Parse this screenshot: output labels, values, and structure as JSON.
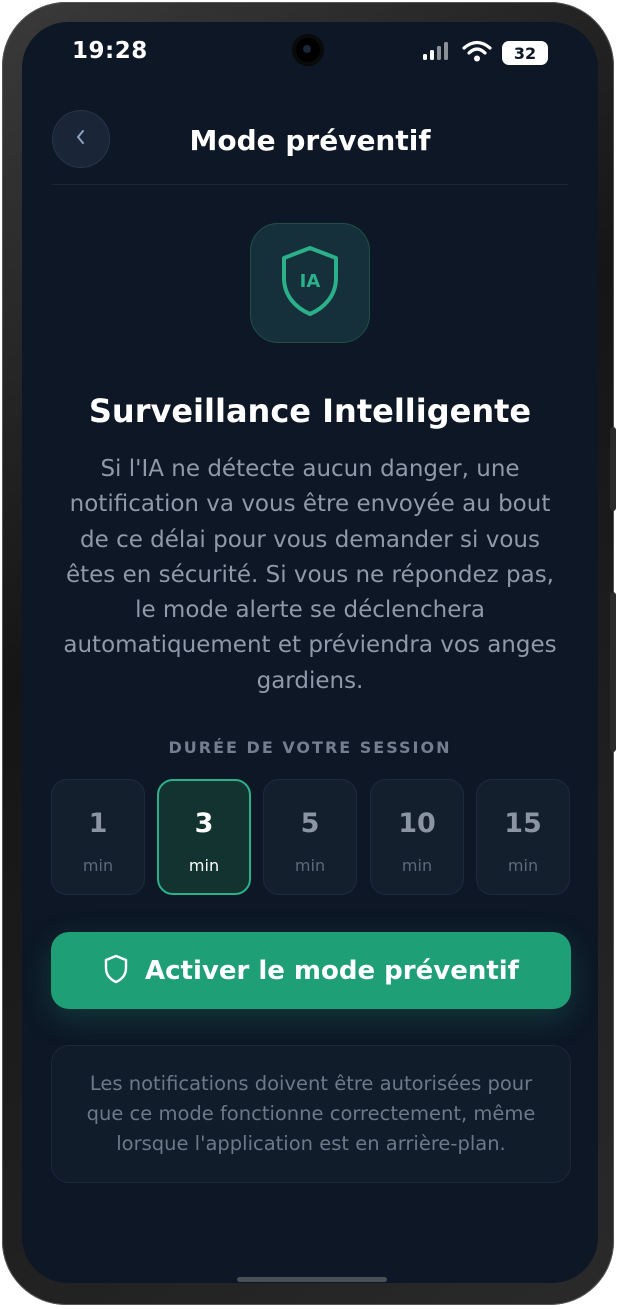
{
  "status_bar": {
    "time": "19:28",
    "battery": "32"
  },
  "header": {
    "back_symbol": "‹",
    "title": "Mode préventif"
  },
  "hero": {
    "icon_text": "IA",
    "title": "Surveillance Intelligente",
    "description": "Si l'IA ne détecte aucun danger, une notification va vous être envoyée au bout de ce délai pour vous demander si vous êtes en sécurité. Si vous ne répondez pas, le mode alerte se déclenchera automatiquement et préviendra vos anges gardiens."
  },
  "duration": {
    "label": "DURÉE DE VOTRE SESSION",
    "selected": "3",
    "options": [
      {
        "value": "1",
        "unit": "min"
      },
      {
        "value": "3",
        "unit": "min"
      },
      {
        "value": "5",
        "unit": "min"
      },
      {
        "value": "10",
        "unit": "min"
      },
      {
        "value": "15",
        "unit": "min"
      }
    ]
  },
  "activate_button": {
    "label": "Activer le mode préventif",
    "icon": "shield-icon"
  },
  "info": {
    "text": "Les notifications doivent être autorisées pour que ce mode fonctionne correctement, même lorsque l'application est en arrière-plan."
  },
  "colors": {
    "background": "#0d1726",
    "accent": "#1f9f76",
    "accent_border": "#2bb08a",
    "text_primary": "#ffffff",
    "text_secondary": "#8f99a8"
  }
}
